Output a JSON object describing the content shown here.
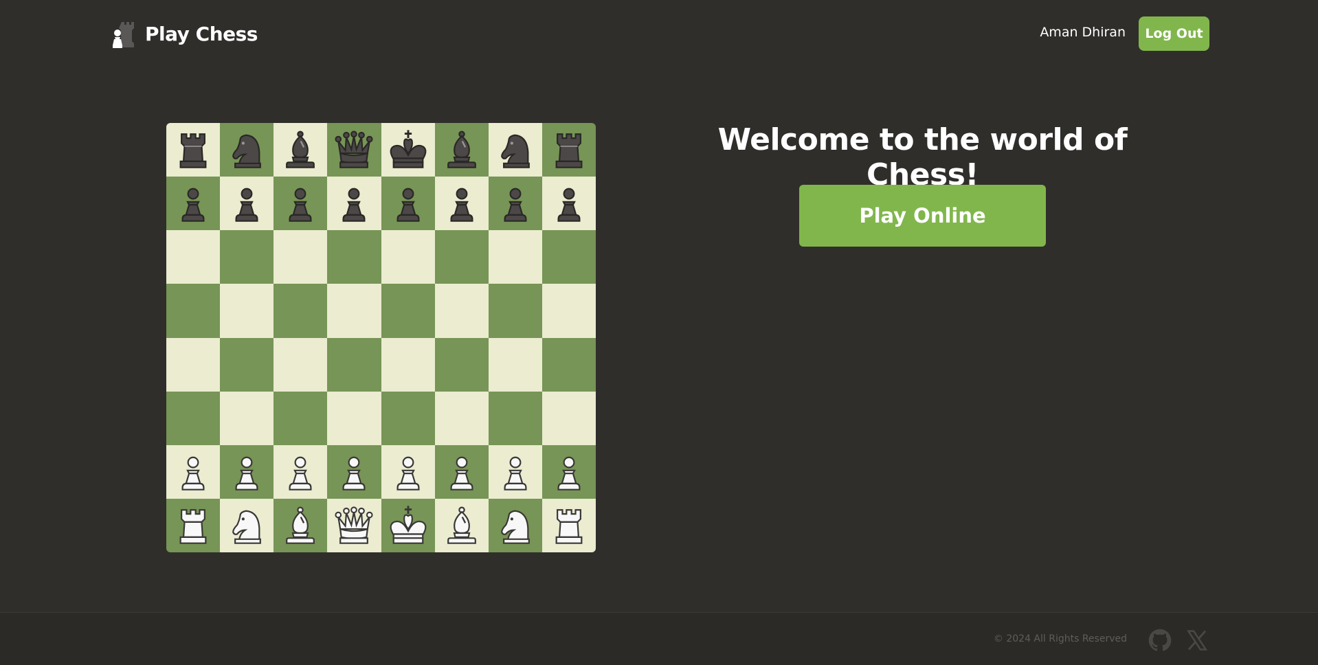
{
  "header": {
    "brand_name": "Play Chess",
    "user_name": "Aman Dhiran",
    "logout_label": "Log Out"
  },
  "main": {
    "welcome_title": "Welcome to the world of Chess!",
    "play_online_label": "Play Online"
  },
  "board": {
    "light_color": "#ebecd0",
    "dark_color": "#779556",
    "position": [
      [
        "bR",
        "bN",
        "bB",
        "bQ",
        "bK",
        "bB",
        "bN",
        "bR"
      ],
      [
        "bP",
        "bP",
        "bP",
        "bP",
        "bP",
        "bP",
        "bP",
        "bP"
      ],
      [
        "",
        "",
        "",
        "",
        "",
        "",
        "",
        ""
      ],
      [
        "",
        "",
        "",
        "",
        "",
        "",
        "",
        ""
      ],
      [
        "",
        "",
        "",
        "",
        "",
        "",
        "",
        ""
      ],
      [
        "",
        "",
        "",
        "",
        "",
        "",
        "",
        ""
      ],
      [
        "wP",
        "wP",
        "wP",
        "wP",
        "wP",
        "wP",
        "wP",
        "wP"
      ],
      [
        "wR",
        "wN",
        "wB",
        "wQ",
        "wK",
        "wB",
        "wN",
        "wR"
      ]
    ]
  },
  "footer": {
    "copyright": "© 2024 All Rights Reserved",
    "social": [
      {
        "icon": "github-icon"
      },
      {
        "icon": "x-icon"
      }
    ]
  },
  "colors": {
    "background": "#302e2b",
    "accent": "#81b64c",
    "footer_text": "#5f5d5a"
  }
}
